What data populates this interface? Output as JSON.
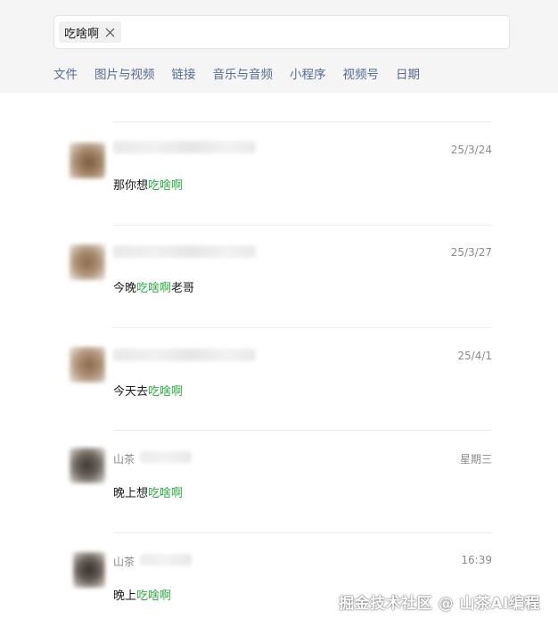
{
  "search": {
    "keyword": "吃啥啊"
  },
  "filters": [
    "文件",
    "图片与视频",
    "链接",
    "音乐与音频",
    "小程序",
    "视频号",
    "日期"
  ],
  "results": [
    {
      "sender": "",
      "date": "25/3/24",
      "msg_before": "那你想",
      "msg_keyword": "吃啥啊",
      "msg_after": ""
    },
    {
      "sender": "",
      "date": "25/3/27",
      "msg_before": "今晚",
      "msg_keyword": "吃啥啊",
      "msg_after": "老哥"
    },
    {
      "sender": "",
      "date": "25/4/1",
      "msg_before": "今天去",
      "msg_keyword": "吃啥啊",
      "msg_after": ""
    },
    {
      "sender": "山茶",
      "date": "星期三",
      "msg_before": "晚上想",
      "msg_keyword": "吃啥啊",
      "msg_after": ""
    },
    {
      "sender": "山茶",
      "date": "16:39",
      "msg_before": "晚上",
      "msg_keyword": "吃啥啊",
      "msg_after": ""
    }
  ],
  "watermark": "掘金技术社区 @ 山茶AI编程",
  "colors": {
    "highlight": "#2aae3f",
    "filter_link": "#576b95",
    "top_background": "#f5f5f5"
  },
  "icons": {
    "chip_close": "close-icon"
  }
}
